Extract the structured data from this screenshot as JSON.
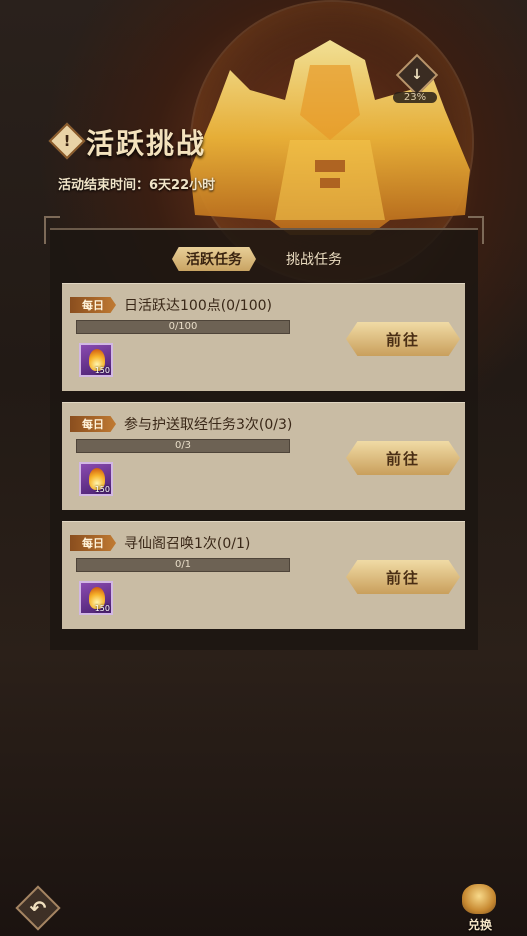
{
  "header": {
    "title": "活跃挑战",
    "title_badge_icon": "exclamation-icon",
    "end_time": "活动结束时间：6天22小时",
    "progress_icon": "down-arrow-icon",
    "progress_percent": "23%"
  },
  "tabs": [
    {
      "label": "活跃任务",
      "active": true
    },
    {
      "label": "挑战任务",
      "active": false
    }
  ],
  "tasks": [
    {
      "tag": "每日",
      "name": "日活跃达100点(0/100)",
      "progress_text": "0/100",
      "progress": 0,
      "reward_icon": "flame-icon",
      "reward_qty": "150",
      "button": "前往"
    },
    {
      "tag": "每日",
      "name": "参与护送取经任务3次(0/3)",
      "progress_text": "0/3",
      "progress": 0,
      "reward_icon": "flame-icon",
      "reward_qty": "150",
      "button": "前往"
    },
    {
      "tag": "每日",
      "name": "寻仙阁召唤1次(0/1)",
      "progress_text": "0/1",
      "progress": 0,
      "reward_icon": "flame-icon",
      "reward_qty": "150",
      "button": "前往"
    }
  ],
  "footer": {
    "back_icon": "back-arrow-icon",
    "exchange_icon": "treasure-pot-icon",
    "exchange_label": "兑换"
  },
  "colors": {
    "accent_gold": "#d8a94c",
    "card_bg": "#c9bca4",
    "panel_bg": "#1c1612"
  }
}
